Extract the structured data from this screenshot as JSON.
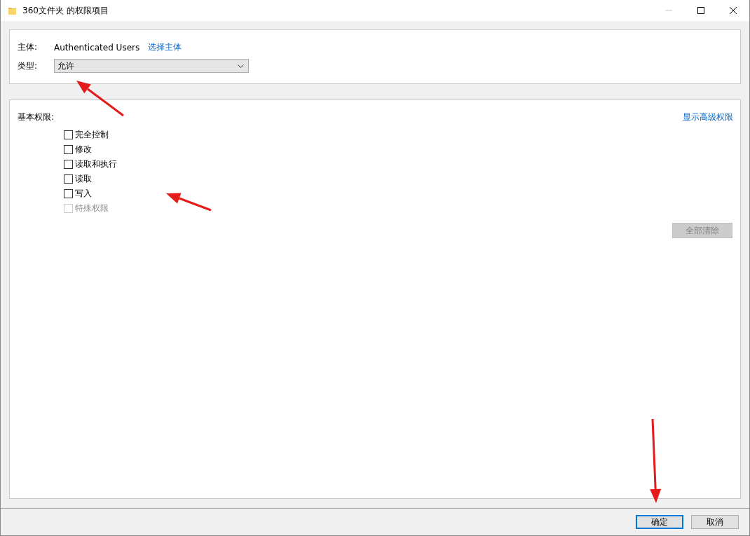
{
  "window": {
    "title": "360文件夹 的权限项目",
    "controls": [
      {
        "kind": "minimize",
        "disabled": true
      },
      {
        "kind": "maximize",
        "disabled": false
      },
      {
        "kind": "close",
        "disabled": false
      }
    ]
  },
  "principal": {
    "label": "主体:",
    "value": "Authenticated Users",
    "link": "选择主体"
  },
  "type": {
    "label": "类型:",
    "value": "允许"
  },
  "permissions": {
    "label": "基本权限:",
    "link": "显示高级权限",
    "items": [
      {
        "label": "完全控制",
        "checked": false,
        "disabled": false
      },
      {
        "label": "修改",
        "checked": false,
        "disabled": false
      },
      {
        "label": "读取和执行",
        "checked": false,
        "disabled": false
      },
      {
        "label": "读取",
        "checked": false,
        "disabled": false
      },
      {
        "label": "写入",
        "checked": false,
        "disabled": false
      },
      {
        "label": "特殊权限",
        "checked": false,
        "disabled": true
      }
    ],
    "clear_button": {
      "label": "全部清除",
      "disabled": true
    }
  },
  "buttons": [
    {
      "label": "确定",
      "default": true
    },
    {
      "label": "取消",
      "default": false
    }
  ]
}
